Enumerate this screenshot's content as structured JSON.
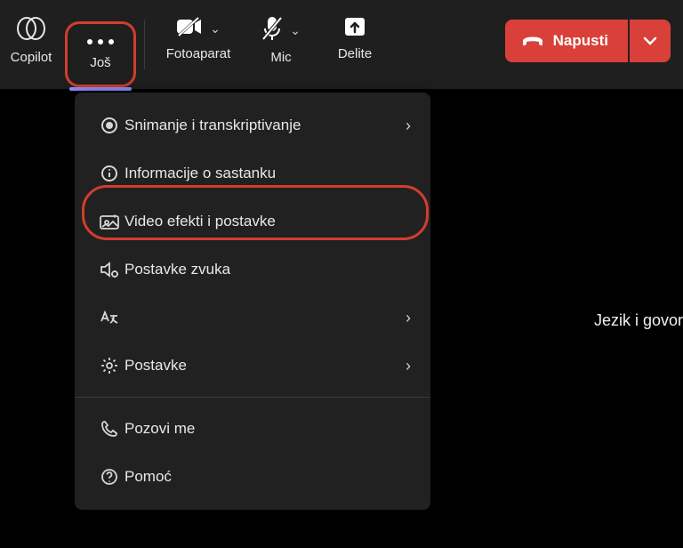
{
  "toolbar": {
    "copilot": "Copilot",
    "more": "Još",
    "camera": "Fotoaparat",
    "mic": "Mic",
    "share": "Delite",
    "leave": "Napusti"
  },
  "menu": {
    "record": "Snimanje i transkriptivanje",
    "meeting_info": "Informacije o sastanku",
    "video_effects": "Video efekti i postavke",
    "audio_settings": "Postavke zvuka",
    "language": "",
    "settings": "Postavke",
    "call_me": "Pozovi me",
    "help": "Pomoć"
  },
  "side_label": "Jezik i govor"
}
